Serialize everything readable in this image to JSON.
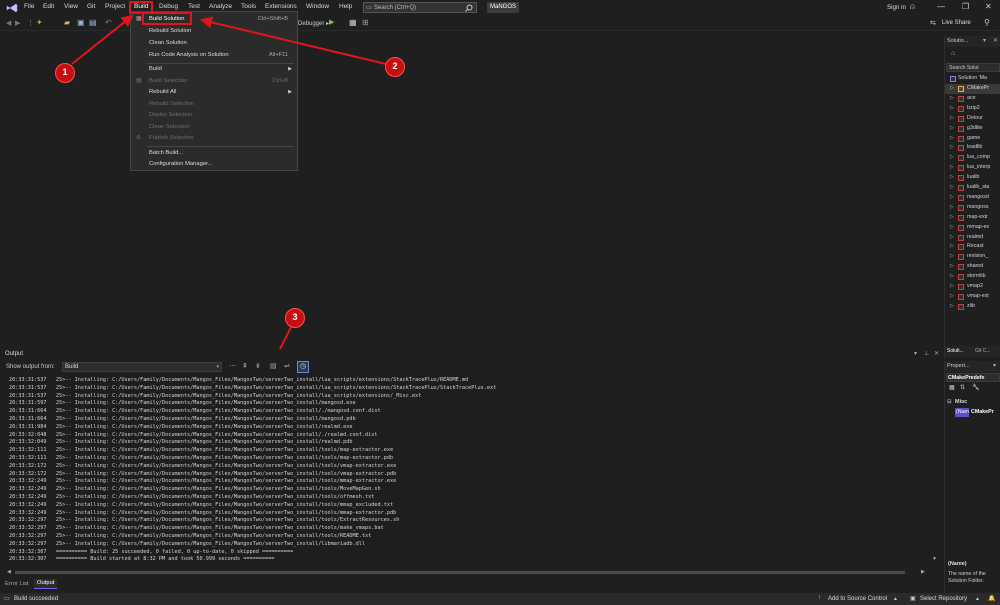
{
  "menubar": {
    "items": [
      "File",
      "Edit",
      "View",
      "Git",
      "Project",
      "Build",
      "Debug",
      "Test",
      "Analyze",
      "Tools",
      "Extensions",
      "Window",
      "Help"
    ],
    "search_placeholder": "Search (Ctrl+Q)",
    "solution_name": "MaNGOS",
    "sign_in": "Sign in",
    "live_share": "Live Share"
  },
  "toolbar": {
    "debugger_label": "Debugger ▸"
  },
  "build_menu": {
    "items": [
      {
        "label": "Build Solution",
        "shortcut": "Ctrl+Shift+B",
        "disabled": false
      },
      {
        "label": "Rebuild Solution",
        "shortcut": "",
        "disabled": false
      },
      {
        "label": "Clean Solution",
        "shortcut": "",
        "disabled": false
      },
      {
        "label": "Run Code Analysis on Solution",
        "shortcut": "Alt+F11",
        "disabled": false
      },
      {
        "label": "Build",
        "shortcut": "",
        "disabled": false,
        "submenu": true
      },
      {
        "label": "Build Selection",
        "shortcut": "Ctrl+B",
        "disabled": true
      },
      {
        "label": "Rebuild All",
        "shortcut": "",
        "disabled": false,
        "submenu": true
      },
      {
        "label": "Rebuild Selection",
        "shortcut": "",
        "disabled": true
      },
      {
        "label": "Deploy Selection",
        "shortcut": "",
        "disabled": true
      },
      {
        "label": "Clean Selection",
        "shortcut": "",
        "disabled": true
      },
      {
        "label": "Publish Selection",
        "shortcut": "",
        "disabled": true
      },
      {
        "label": "Batch Build...",
        "shortcut": "",
        "disabled": false
      },
      {
        "label": "Configuration Manager...",
        "shortcut": "",
        "disabled": false
      }
    ]
  },
  "callouts": [
    "1",
    "2",
    "3"
  ],
  "solution_explorer": {
    "title": "Solutio...",
    "search": "Search Solut",
    "solution": "Solution 'Ma",
    "items": [
      "CMakePr",
      "ace",
      "bzip2",
      "Detour",
      "g3dlite",
      "game",
      "loadlib",
      "lua_comp",
      "lua_interp",
      "lualib",
      "lualib_sta",
      "mangosd",
      "mangoss",
      "map-extr",
      "mmap-ex",
      "realmd",
      "Recast",
      "revision_",
      "shared",
      "stormlib",
      "vmap2",
      "vmap-ext",
      "zlib"
    ],
    "tab_solution": "Soluti...",
    "tab_git": "Git C..."
  },
  "properties": {
    "title": "Propert...",
    "selected": "CMakePredefe",
    "category": "Misc",
    "prop_name": "(Nam",
    "prop_value": "CMakePr",
    "desc_title": "(Name)",
    "desc_text": "The name of the Solution Folder."
  },
  "output": {
    "title": "Output",
    "show_from_label": "Show output from:",
    "show_from_value": "Build",
    "lines": [
      "20:33:31:537   25>-- Installing: C:/Users/Family/Documents/Mangos_Files/MangosTwo/serverTwo_install/lua_scripts/extensions/StackTracePlus/README.md",
      "20:33:31:537   25>-- Installing: C:/Users/Family/Documents/Mangos_Files/MangosTwo/serverTwo_install/lua_scripts/extensions/StackTracePlus/StackTracePlus.ext",
      "20:33:31:537   25>-- Installing: C:/Users/Family/Documents/Mangos_Files/MangosTwo/serverTwo_install/lua_scripts/extensions/_Misc.ext",
      "20:33:31:597   25>-- Installing: C:/Users/Family/Documents/Mangos_Files/MangosTwo/serverTwo_install/mangosd.exe",
      "20:33:31:664   25>-- Installing: C:/Users/Family/Documents/Mangos_Files/MangosTwo/serverTwo_install/./mangosd.conf.dist",
      "20:33:31:664   25>-- Installing: C:/Users/Family/Documents/Mangos_Files/MangosTwo/serverTwo_install/mangosd.pdb",
      "20:33:31:984   25>-- Installing: C:/Users/Family/Documents/Mangos_Files/MangosTwo/serverTwo_install/realmd.exe",
      "20:33:32:048   25>-- Installing: C:/Users/Family/Documents/Mangos_Files/MangosTwo/serverTwo_install/./realmd.conf.dist",
      "20:33:32:049   25>-- Installing: C:/Users/Family/Documents/Mangos_Files/MangosTwo/serverTwo_install/realmd.pdb",
      "20:33:32:111   25>-- Installing: C:/Users/Family/Documents/Mangos_Files/MangosTwo/serverTwo_install/tools/map-extractor.exe",
      "20:33:32:111   25>-- Installing: C:/Users/Family/Documents/Mangos_Files/MangosTwo/serverTwo_install/tools/map-extractor.pdb",
      "20:33:32:172   25>-- Installing: C:/Users/Family/Documents/Mangos_Files/MangosTwo/serverTwo_install/tools/vmap-extractor.exe",
      "20:33:32:172   25>-- Installing: C:/Users/Family/Documents/Mangos_Files/MangosTwo/serverTwo_install/tools/vmap-extractor.pdb",
      "20:33:32:249   25>-- Installing: C:/Users/Family/Documents/Mangos_Files/MangosTwo/serverTwo_install/tools/mmap-extractor.exe",
      "20:33:32:249   25>-- Installing: C:/Users/Family/Documents/Mangos_Files/MangosTwo/serverTwo_install/tools/MoveMapGen.sh",
      "20:33:32:249   25>-- Installing: C:/Users/Family/Documents/Mangos_Files/MangosTwo/serverTwo_install/tools/offmesh.txt",
      "20:33:32:249   25>-- Installing: C:/Users/Family/Documents/Mangos_Files/MangosTwo/serverTwo_install/tools/mmap_excluded.txt",
      "20:33:32:249   25>-- Installing: C:/Users/Family/Documents/Mangos_Files/MangosTwo/serverTwo_install/tools/mmap-extractor.pdb",
      "20:33:32:297   25>-- Installing: C:/Users/Family/Documents/Mangos_Files/MangosTwo/serverTwo_install/tools/ExtractResources.sh",
      "20:33:32:297   25>-- Installing: C:/Users/Family/Documents/Mangos_Files/MangosTwo/serverTwo_install/tools/make_vmaps.bat",
      "20:33:32:297   25>-- Installing: C:/Users/Family/Documents/Mangos_Files/MangosTwo/serverTwo_install/tools/README.txt",
      "20:33:32:297   25>-- Installing: C:/Users/Family/Documents/Mangos_Files/MangosTwo/serverTwo_install/libmariadb.dll",
      "20:33:32:307   ========== Build: 25 succeeded, 0 failed, 0 up-to-date, 0 skipped ==========",
      "20:33:32:307   ========== Build started at 8:32 PM and took 50.999 seconds =========="
    ],
    "tab_error_list": "Error List",
    "tab_output": "Output"
  },
  "status_bar": {
    "status": "Build succeeded",
    "source_control": "Add to Source Control",
    "repository": "Select Repository"
  },
  "colors": {
    "accent": "#7160e8",
    "annotation_red": "#e0141e",
    "status_bar": "#2a2a2a"
  }
}
